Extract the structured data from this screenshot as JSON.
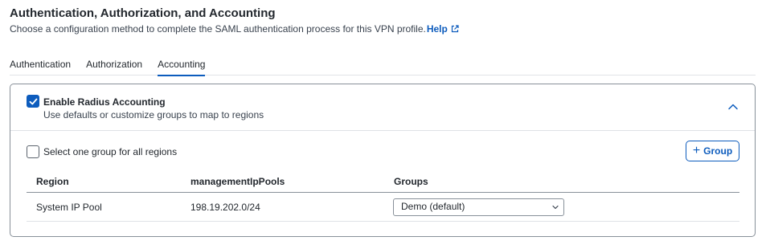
{
  "page": {
    "title": "Authentication, Authorization, and Accounting",
    "subtitle": "Choose a configuration method to complete the SAML authentication process for this VPN profile.",
    "help_label": "Help"
  },
  "tabs": [
    {
      "label": "Authentication",
      "active": false
    },
    {
      "label": "Authorization",
      "active": false
    },
    {
      "label": "Accounting",
      "active": true
    }
  ],
  "accounting": {
    "enable_label": "Enable Radius Accounting",
    "enable_checked": true,
    "enable_description": "Use defaults or customize groups to map to regions",
    "select_one_label": "Select one group for all regions",
    "select_one_checked": false,
    "add_group_label": "Group",
    "table": {
      "columns": [
        "Region",
        "managementIpPools",
        "Groups"
      ],
      "rows": [
        {
          "region": "System IP Pool",
          "pools": "198.19.202.0/24",
          "group": "Demo (default)"
        }
      ]
    }
  },
  "colors": {
    "accent": "#0d5cbd",
    "border": "#889099"
  },
  "icons": {
    "help": "external-link-icon",
    "collapse": "chevron-up-icon",
    "select": "chevron-down-icon",
    "add": "plus-icon"
  }
}
